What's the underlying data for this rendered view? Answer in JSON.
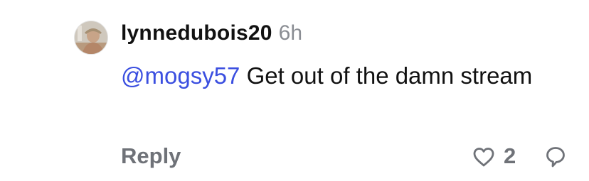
{
  "comment": {
    "username": "lynnedubois20",
    "time": "6h",
    "mention": "@mogsy57",
    "text": " Get out of the damn stream",
    "reply_label": "Reply",
    "like_count": "2",
    "avatar_icon": "avatar-photo",
    "like_icon": "heart-outline-icon",
    "reply_icon": "speech-bubble-icon"
  },
  "colors": {
    "mention": "#3b4fe0",
    "muted": "#6f7278",
    "time": "#8a8d93",
    "text": "#111111"
  }
}
